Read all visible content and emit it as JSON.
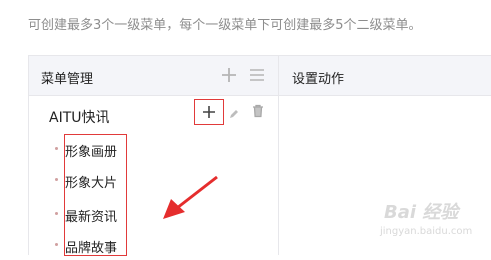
{
  "notice": "可创建最多3个一级菜单，每个一级菜单下可创建最多5个二级菜单。",
  "header": {
    "menu_management": "菜单管理",
    "set_action": "设置动作"
  },
  "menu": {
    "name": "AITU快讯",
    "sub_items": [
      "形象画册",
      "形象大片",
      "最新资讯",
      "品牌故事"
    ]
  },
  "icons": {
    "header_add": "plus-icon",
    "header_sort": "list-icon",
    "row_add": "plus-icon",
    "row_edit": "pencil-icon",
    "row_delete": "trash-icon"
  },
  "colors": {
    "highlight": "#e13a3a",
    "header_bg": "#f4f5f9",
    "border": "#e7e7eb",
    "muted_text": "#8d8d8d"
  },
  "watermark": {
    "text": "Bai 经验",
    "url": "jingyan.baidu.com"
  }
}
